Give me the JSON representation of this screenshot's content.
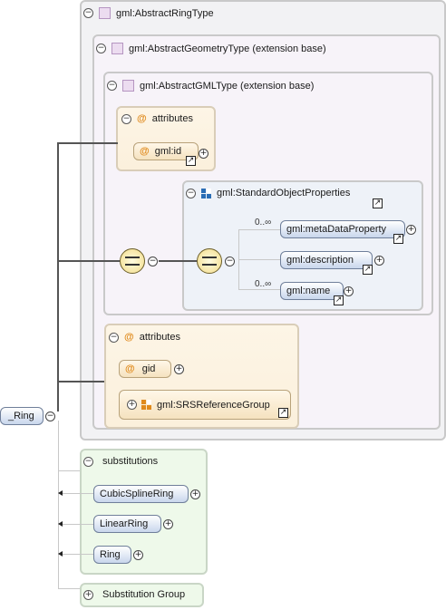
{
  "root_element": {
    "label": "_Ring"
  },
  "type_box": {
    "title": "gml:AbstractRingType",
    "geometry_base": {
      "title": "gml:AbstractGeometryType (extension base)",
      "gml_base": {
        "title": "gml:AbstractGMLType (extension base)",
        "attributes": {
          "title": "attributes",
          "items": [
            "gml:id"
          ]
        },
        "standard_props": {
          "title": "gml:StandardObjectProperties",
          "items": [
            {
              "label": "gml:metaDataProperty",
              "cardinality": "0..∞"
            },
            {
              "label": "gml:description",
              "cardinality": ""
            },
            {
              "label": "gml:name",
              "cardinality": "0..∞"
            }
          ]
        }
      }
    },
    "attributes": {
      "title": "attributes",
      "attr": "gid",
      "group": "gml:SRSReferenceGroup"
    }
  },
  "substitutions": {
    "title": "substitutions",
    "items": [
      "CubicSplineRing",
      "LinearRing",
      "Ring"
    ]
  },
  "substitution_group": {
    "title": "Substitution Group"
  },
  "icons": {
    "collapse": "minus-circle-icon",
    "expand": "plus-circle-icon",
    "jump": "link-arrow-icon"
  },
  "colors": {
    "element_fill": "#c8d6ec",
    "attribute_fill": "#f5e2bf",
    "substitution_fill": "#eef9ea",
    "type_fill": "#ecdcf0"
  }
}
